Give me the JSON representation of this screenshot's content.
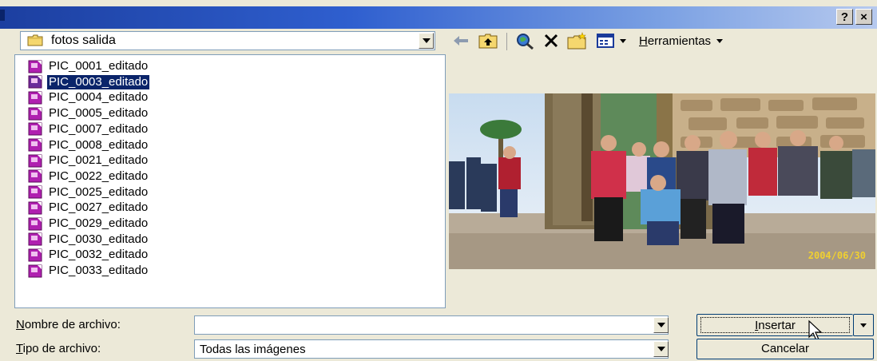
{
  "title_bar": {
    "help_button": "?",
    "close_button": "×"
  },
  "look_in": {
    "value": "fotos salida"
  },
  "toolbar": {
    "tools_label": "Herramientas",
    "tools_accesskey": "H",
    "tools_rest": "erramientas"
  },
  "files": [
    "PIC_0001_editado",
    "PIC_0003_editado",
    "PIC_0004_editado",
    "PIC_0005_editado",
    "PIC_0007_editado",
    "PIC_0008_editado",
    "PIC_0021_editado",
    "PIC_0022_editado",
    "PIC_0025_editado",
    "PIC_0027_editado",
    "PIC_0029_editado",
    "PIC_0030_editado",
    "PIC_0032_editado",
    "PIC_0033_editado"
  ],
  "selected_file": "PIC_0003_editado",
  "preview": {
    "photo_date": "2004/06/30"
  },
  "filename": {
    "label_key": "N",
    "label_rest": "ombre de archivo:",
    "value": ""
  },
  "filetype": {
    "label_key": "T",
    "label_rest": "ipo de archivo:",
    "value": "Todas las imágenes"
  },
  "buttons": {
    "insert_key": "I",
    "insert_rest": "nsertar",
    "cancel": "Cancelar"
  },
  "colors": {
    "selection": "#0a246a",
    "titlebar": "#2f5fcf",
    "file_icon": "#b020b0"
  }
}
